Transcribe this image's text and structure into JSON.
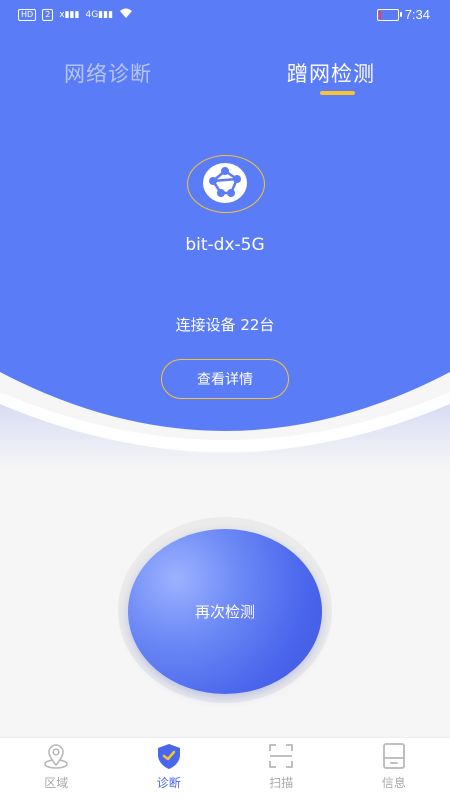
{
  "status_bar": {
    "left_chip": "HD",
    "left_chip2": "2",
    "signal_1": "x",
    "signal_2": "4G",
    "time": "7:34",
    "battery_level": 0.1
  },
  "tabs": [
    {
      "label": "网络诊断",
      "active": false
    },
    {
      "label": "蹭网检测",
      "active": true
    }
  ],
  "network": {
    "icon": "network-globe-icon",
    "ssid": "bit-dx-5G",
    "devices_text": "连接设备 22台",
    "detail_button": "查看详情"
  },
  "action": {
    "redetect_label": "再次检测"
  },
  "bottom_nav": [
    {
      "label": "区域",
      "icon": "location-icon",
      "active": false
    },
    {
      "label": "诊断",
      "icon": "shield-check-icon",
      "active": true
    },
    {
      "label": "扫描",
      "icon": "scan-icon",
      "active": false
    },
    {
      "label": "信息",
      "icon": "info-device-icon",
      "active": false
    }
  ],
  "colors": {
    "primary": "#5b7cf7",
    "accent": "#f5c430",
    "nav_active": "#4a66ec",
    "nav_inactive": "#a9a9a9"
  }
}
